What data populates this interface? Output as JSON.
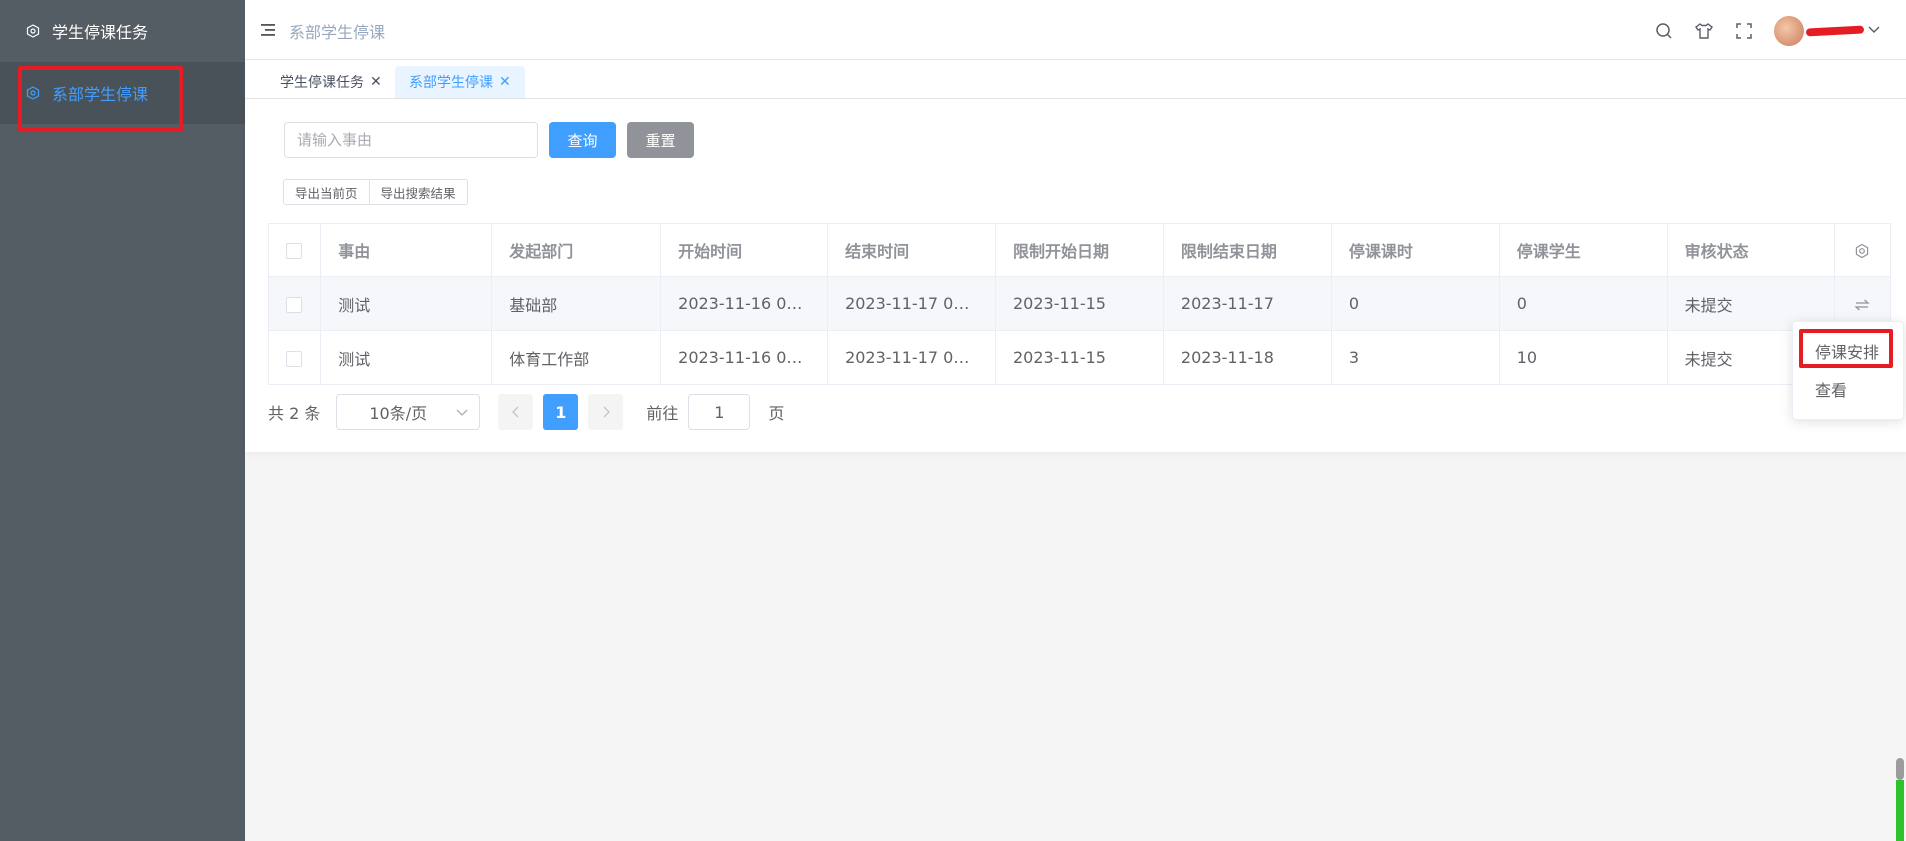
{
  "sidebar": {
    "items": [
      {
        "label": "学生停课任务",
        "icon": "hexagon-gear-icon",
        "active": false
      },
      {
        "label": "系部学生停课",
        "icon": "hexagon-gear-icon",
        "active": true
      }
    ]
  },
  "header": {
    "breadcrumb": "系部学生停课",
    "icons": [
      "search-icon",
      "shirt-icon",
      "fullscreen-icon",
      "chevron-down-icon"
    ]
  },
  "tags": [
    {
      "label": "学生停课任务",
      "active": false
    },
    {
      "label": "系部学生停课",
      "active": true
    }
  ],
  "search": {
    "placeholder": "请输入事由",
    "query_label": "查询",
    "reset_label": "重置"
  },
  "export": {
    "current_page": "导出当前页",
    "search_results": "导出搜索结果"
  },
  "table": {
    "columns": [
      "事由",
      "发起部门",
      "开始时间",
      "结束时间",
      "限制开始日期",
      "限制结束日期",
      "停课课时",
      "停课学生",
      "审核状态"
    ],
    "rows": [
      [
        "测试",
        "基础部",
        "2023-11-16 00:...",
        "2023-11-17 00:...",
        "2023-11-15",
        "2023-11-17",
        "0",
        "0",
        "未提交"
      ],
      [
        "测试",
        "体育工作部",
        "2023-11-16 00:...",
        "2023-11-17 00:...",
        "2023-11-15",
        "2023-11-18",
        "3",
        "10",
        "未提交"
      ]
    ]
  },
  "pager": {
    "total": "共 2 条",
    "page_size": "10条/页",
    "current": "1",
    "goto": "前往",
    "jump_value": "1",
    "page_unit": "页"
  },
  "dropdown": {
    "items": [
      "停课安排",
      "查看"
    ]
  },
  "colors": {
    "accent": "#409eff",
    "sidebar": "#545c64",
    "highlight": "#e51c23"
  }
}
